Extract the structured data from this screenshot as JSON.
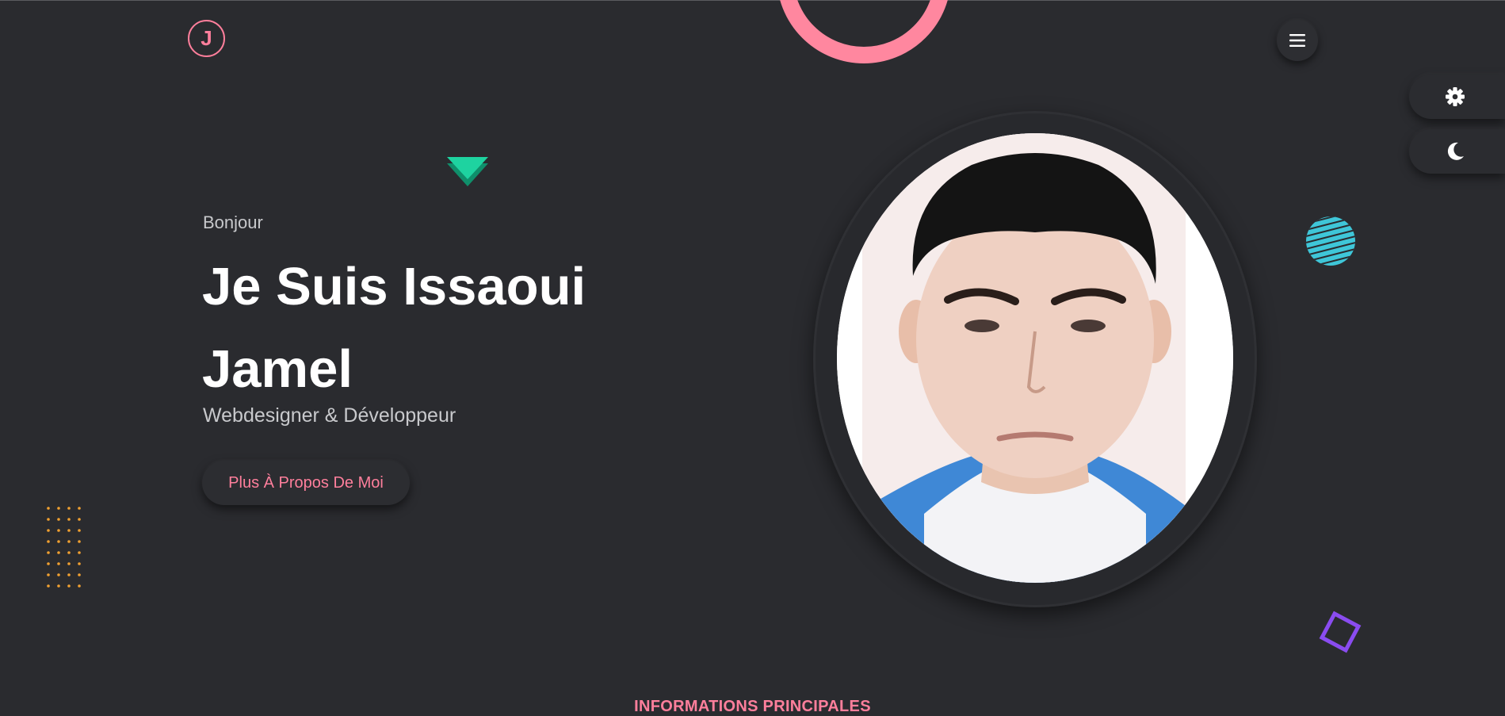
{
  "header": {
    "logo_letter": "J"
  },
  "hero": {
    "greeting": "Bonjour",
    "name_line1": "Je Suis Issaoui",
    "name_line2": "Jamel",
    "role": "Webdesigner & Développeur",
    "cta_label": "Plus À Propos De Moi"
  },
  "side_controls": {
    "settings_icon": "gear-icon",
    "theme_icon": "moon-icon"
  },
  "next_section": {
    "title": "INFORMATIONS PRINCIPALES"
  },
  "colors": {
    "background": "#2a2b2f",
    "accent_pink": "#ff7f9c",
    "accent_green": "#1ed3a0",
    "accent_cyan": "#3fc6d8",
    "accent_purple": "#8a4cf0",
    "accent_orange": "#f0a030"
  }
}
